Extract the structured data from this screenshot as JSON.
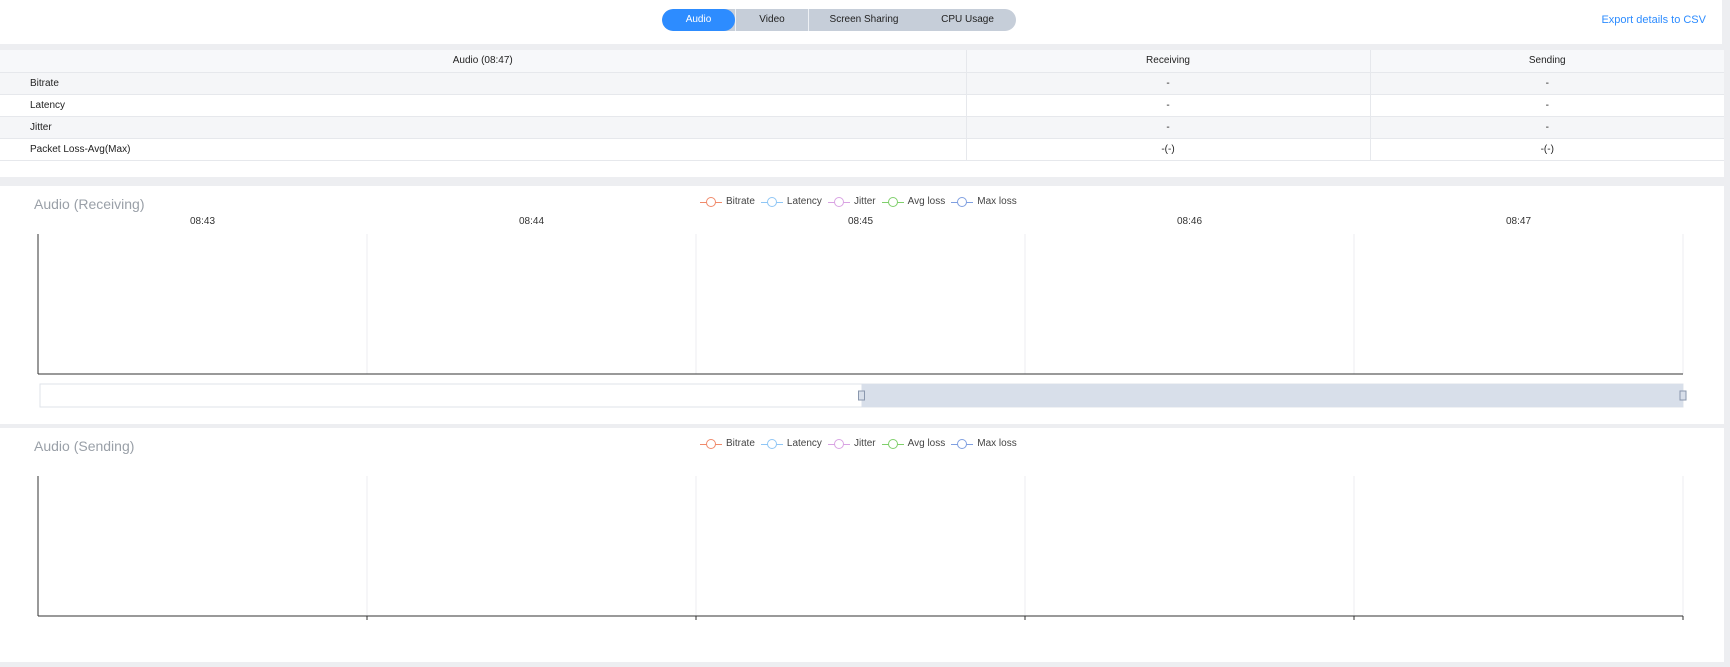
{
  "tabs": [
    {
      "label": "Audio",
      "active": true
    },
    {
      "label": "Video",
      "active": false
    },
    {
      "label": "Screen Sharing",
      "active": false
    },
    {
      "label": "CPU Usage",
      "active": false
    }
  ],
  "export_label": "Export details to CSV",
  "table": {
    "headers": [
      "Audio (08:47)",
      "Receiving",
      "Sending"
    ],
    "rows": [
      {
        "metric": "Bitrate",
        "receiving": "-",
        "sending": "-"
      },
      {
        "metric": "Latency",
        "receiving": "-",
        "sending": "-"
      },
      {
        "metric": "Jitter",
        "receiving": "-",
        "sending": "-"
      },
      {
        "metric": "Packet Loss-Avg(Max)",
        "receiving": "-(-)",
        "sending": "-(-)"
      }
    ]
  },
  "colors": {
    "accent": "#2d8cff",
    "bitrate": "#f08a6b",
    "latency": "#8fc6f5",
    "jitter": "#d9a3e3",
    "avg_loss": "#7fcf6b",
    "max_loss": "#7f9fe0"
  },
  "charts": {
    "receiving": {
      "title": "Audio (Receiving)",
      "legend": [
        "Bitrate",
        "Latency",
        "Jitter",
        "Avg loss",
        "Max loss"
      ],
      "time_labels": [
        "08:43",
        "08:44",
        "08:45",
        "08:46",
        "08:47"
      ],
      "zoom_range_percent": [
        50,
        100
      ]
    },
    "sending": {
      "title": "Audio (Sending)",
      "legend": [
        "Bitrate",
        "Latency",
        "Jitter",
        "Avg loss",
        "Max loss"
      ]
    }
  },
  "chart_data": [
    {
      "type": "line",
      "title": "Audio (Receiving)",
      "x": [
        "08:43",
        "08:44",
        "08:45",
        "08:46",
        "08:47"
      ],
      "series": [
        {
          "name": "Bitrate",
          "values": []
        },
        {
          "name": "Latency",
          "values": []
        },
        {
          "name": "Jitter",
          "values": []
        },
        {
          "name": "Avg loss",
          "values": []
        },
        {
          "name": "Max loss",
          "values": []
        }
      ],
      "grid": true,
      "legend": "top-center"
    },
    {
      "type": "line",
      "title": "Audio (Sending)",
      "series": [
        {
          "name": "Bitrate",
          "values": []
        },
        {
          "name": "Latency",
          "values": []
        },
        {
          "name": "Jitter",
          "values": []
        },
        {
          "name": "Avg loss",
          "values": []
        },
        {
          "name": "Max loss",
          "values": []
        }
      ],
      "grid": true,
      "legend": "top-center"
    }
  ]
}
